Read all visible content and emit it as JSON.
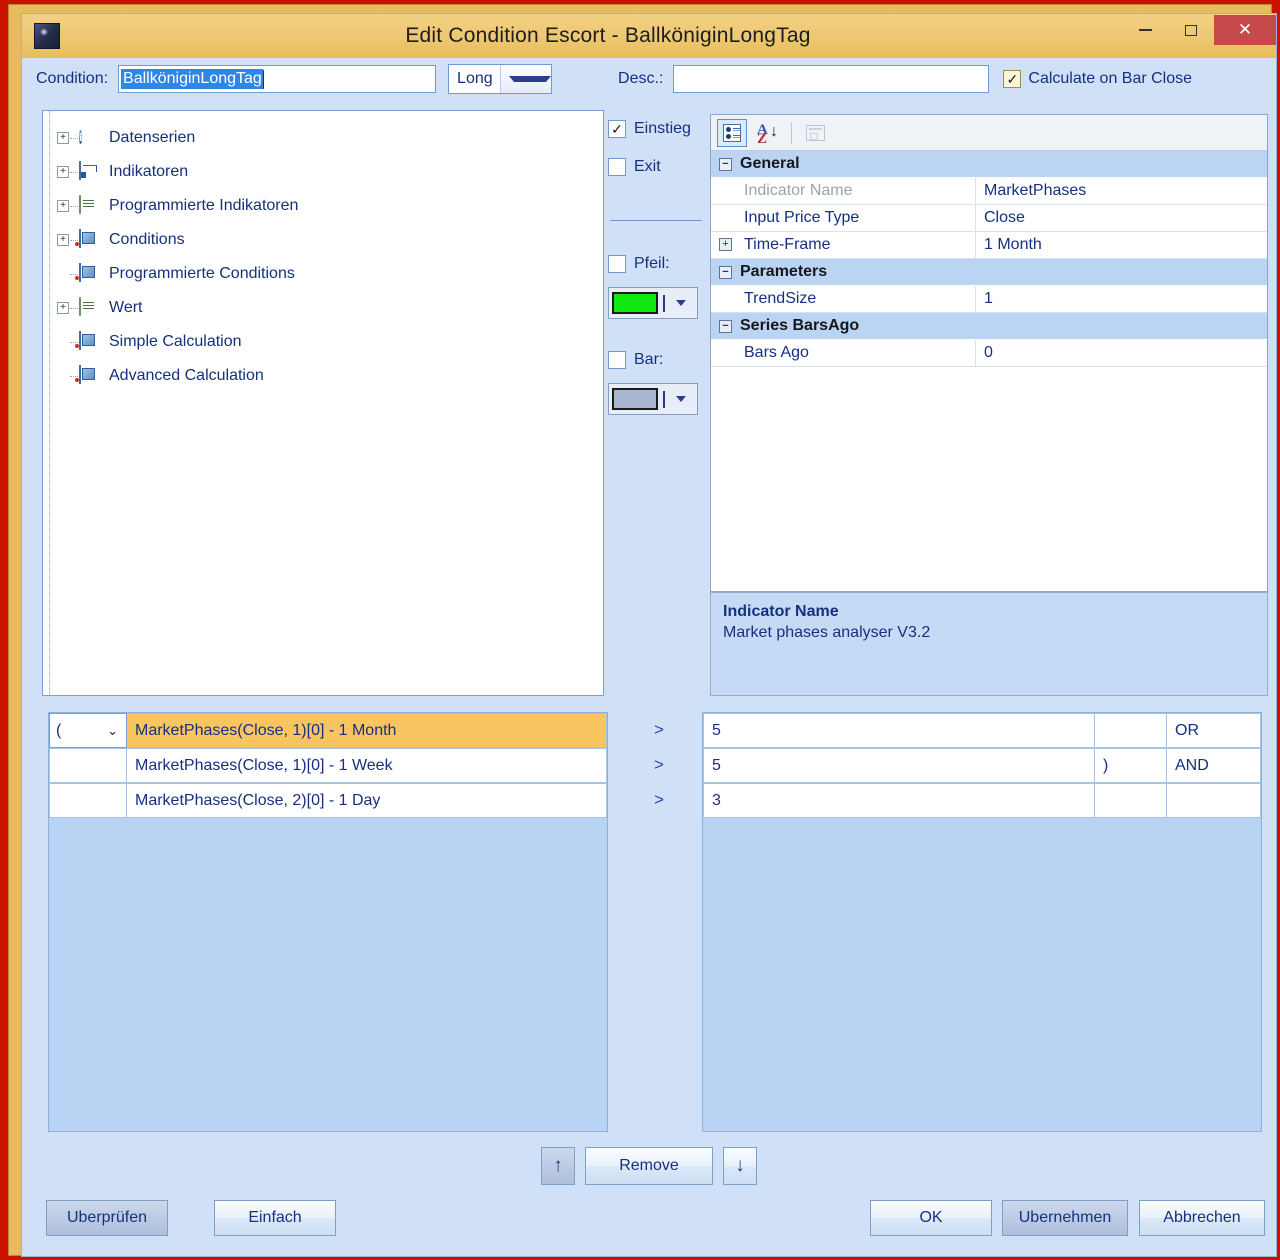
{
  "window": {
    "title": "Edit Condition Escort - BallköniginLongTag",
    "minimize_label": "minimize",
    "maximize_label": "maximize",
    "close_label": "✕",
    "app_icon": "app-window-icon",
    "frame_color": "#cc1100",
    "titlebar_color": "#eec873"
  },
  "header": {
    "condition_label": "Condition:",
    "condition_value": "BallköniginLongTag",
    "direction_value": "Long",
    "desc_label": "Desc.:",
    "desc_value": "",
    "desc_placeholder": "",
    "calculate_on_bar_close_label": "Calculate on Bar Close",
    "calculate_on_bar_close_checked": "✓"
  },
  "tree": {
    "items": [
      {
        "label": "Datenserien",
        "icon": "info-icon",
        "expander": "+",
        "has_expander": true
      },
      {
        "label": "Indikatoren",
        "icon": "chart-indicator-icon",
        "expander": "+",
        "has_expander": true
      },
      {
        "label": "Programmierte Indikatoren",
        "icon": "script-icon",
        "expander": "+",
        "has_expander": true
      },
      {
        "label": "Conditions",
        "icon": "condition-icon",
        "expander": "+",
        "has_expander": true
      },
      {
        "label": "Programmierte Conditions",
        "icon": "condition-icon",
        "expander": "",
        "has_expander": false
      },
      {
        "label": "Wert",
        "icon": "script-icon",
        "expander": "+",
        "has_expander": true
      },
      {
        "label": "Simple Calculation",
        "icon": "condition-icon",
        "expander": "",
        "has_expander": false
      },
      {
        "label": "Advanced Calculation",
        "icon": "condition-icon",
        "expander": "",
        "has_expander": false
      }
    ]
  },
  "middle": {
    "einstieg_label": "Einstieg",
    "einstieg_checked": "✓",
    "exit_label": "Exit",
    "exit_checked": "",
    "pfeil_label": "Pfeil:",
    "pfeil_checked": "",
    "pfeil_color": "#10e810",
    "bar_label": "Bar:",
    "bar_checked": "",
    "bar_color": "#a9b8d0"
  },
  "property_grid": {
    "toolbar": {
      "categorized_label": "categorized-view",
      "alphabetical_label": "alphabetical-sort",
      "property_pages_label": "property-pages"
    },
    "rows": [
      {
        "kind": "category",
        "toggler": "−",
        "name": "General",
        "value": ""
      },
      {
        "kind": "prop",
        "toggler": "",
        "name": "Indicator Name",
        "value": "MarketPhases",
        "disabled": true
      },
      {
        "kind": "prop",
        "toggler": "",
        "name": "Input Price Type",
        "value": "Close",
        "disabled": false
      },
      {
        "kind": "prop",
        "toggler": "+",
        "name": "Time-Frame",
        "value": "1 Month",
        "disabled": false
      },
      {
        "kind": "category",
        "toggler": "−",
        "name": "Parameters",
        "value": ""
      },
      {
        "kind": "prop",
        "toggler": "",
        "name": "TrendSize",
        "value": "1",
        "disabled": false
      },
      {
        "kind": "category",
        "toggler": "−",
        "name": "Series BarsAgo",
        "value": ""
      },
      {
        "kind": "prop",
        "toggler": "",
        "name": "Bars Ago",
        "value": "0",
        "disabled": false
      }
    ]
  },
  "description": {
    "title": "Indicator Name",
    "body": "Market phases analyser V3.2"
  },
  "condition_rows": [
    {
      "paren": "(",
      "has_dropdown": true,
      "expression": "MarketPhases(Close, 1)[0] - 1 Month",
      "selected": true,
      "operator": ">",
      "value": "5",
      "close_paren": "",
      "logic": "OR"
    },
    {
      "paren": "",
      "has_dropdown": false,
      "expression": "MarketPhases(Close, 1)[0] - 1 Week",
      "selected": false,
      "operator": ">",
      "value": "5",
      "close_paren": ")",
      "logic": "AND"
    },
    {
      "paren": "",
      "has_dropdown": false,
      "expression": "MarketPhases(Close, 2)[0] - 1 Day",
      "selected": false,
      "operator": ">",
      "value": "3",
      "close_paren": "",
      "logic": ""
    }
  ],
  "footer": {
    "move_up_label": "↑",
    "remove_label": "Remove",
    "move_down_label": "↓",
    "check_label": "Uberprüfen",
    "simple_label": "Einfach",
    "ok_label": "OK",
    "apply_label": "Ubernehmen",
    "cancel_label": "Abbrechen"
  }
}
